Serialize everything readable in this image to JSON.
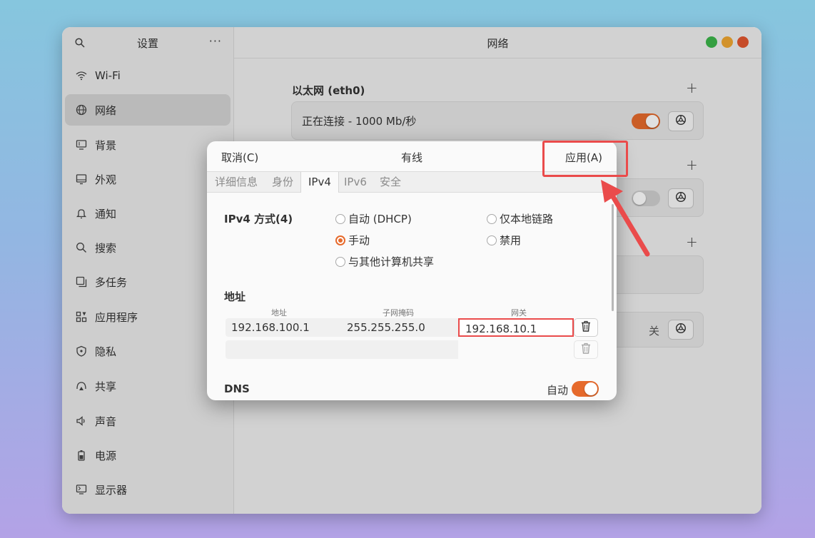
{
  "sidebar": {
    "title": "设置",
    "more": "···",
    "items": [
      {
        "label": "Wi-Fi",
        "icon": "wifi-icon"
      },
      {
        "label": "网络",
        "icon": "globe-icon",
        "active": true
      },
      {
        "label": "背景",
        "icon": "monitor-icon"
      },
      {
        "label": "外观",
        "icon": "appearance-icon"
      },
      {
        "label": "通知",
        "icon": "bell-icon"
      },
      {
        "label": "搜索",
        "icon": "search-icon"
      },
      {
        "label": "多任务",
        "icon": "multitask-icon"
      },
      {
        "label": "应用程序",
        "icon": "apps-icon"
      },
      {
        "label": "隐私",
        "icon": "shield-icon"
      },
      {
        "label": "共享",
        "icon": "share-icon"
      },
      {
        "label": "声音",
        "icon": "speaker-icon"
      },
      {
        "label": "电源",
        "icon": "battery-icon"
      },
      {
        "label": "显示器",
        "icon": "display-icon"
      }
    ]
  },
  "main": {
    "title": "网络",
    "ethernet_title": "以太网 (eth0)",
    "ethernet_status": "正在连接 - 1000 Mb/秒",
    "proxy_state": "关"
  },
  "colors": {
    "accent": "#e66a2c",
    "close": "#e2572f",
    "minimize": "#f0a731",
    "maximize": "#3cb54a",
    "highlight": "#ea4b4b"
  },
  "dialog": {
    "cancel": "取消(C)",
    "title": "有线",
    "apply": "应用(A)",
    "tabs": [
      "详细信息",
      "身份",
      "IPv4",
      "IPv6",
      "安全"
    ],
    "active_tab": "IPv4",
    "ipv4_method_label": "IPv4 方式(4)",
    "methods": {
      "auto": "自动 (DHCP)",
      "link_local": "仅本地链路",
      "manual": "手动",
      "disabled": "禁用",
      "shared": "与其他计算机共享"
    },
    "selected_method": "手动",
    "address_section": "地址",
    "columns": {
      "address": "地址",
      "netmask": "子网掩码",
      "gateway": "网关"
    },
    "rows": [
      {
        "address": "192.168.100.1",
        "netmask": "255.255.255.0",
        "gateway": "192.168.10.1"
      },
      {
        "address": "",
        "netmask": "",
        "gateway": ""
      }
    ],
    "dns_label": "DNS",
    "dns_auto_label": "自动",
    "dns_auto": true
  }
}
